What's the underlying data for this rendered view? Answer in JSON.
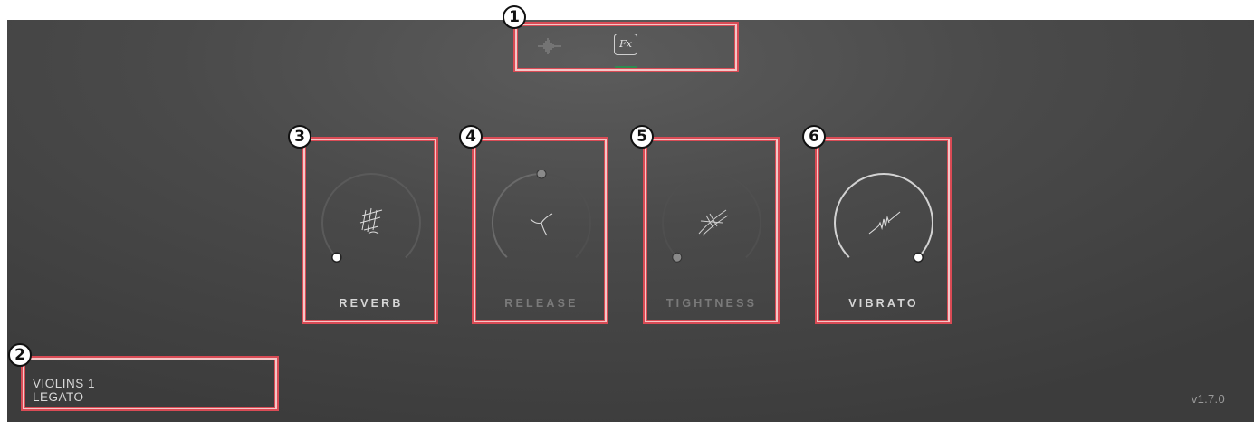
{
  "header": {
    "tabs": [
      {
        "icon": "waveform-icon",
        "active": false
      },
      {
        "icon": "fx-icon",
        "label": "Fx",
        "active": true
      }
    ]
  },
  "knobs": [
    {
      "label": "REVERB",
      "icon": "reverb-icon",
      "value": 0.0,
      "enabled": true
    },
    {
      "label": "RELEASE",
      "icon": "release-icon",
      "value": 0.5,
      "enabled": false
    },
    {
      "label": "TIGHTNESS",
      "icon": "tightness-icon",
      "value": 0.0,
      "enabled": false
    },
    {
      "label": "VIBRATO",
      "icon": "vibrato-icon",
      "value": 1.0,
      "enabled": true
    }
  ],
  "instrument": {
    "name": "VIOLINS 1",
    "articulation": "LEGATO"
  },
  "version": "v1.7.0",
  "callouts": [
    "1",
    "2",
    "3",
    "4",
    "5",
    "6"
  ],
  "colors": {
    "accent": "#2e8a52",
    "callout": "#d94b55",
    "background": "#4a4a4a"
  }
}
